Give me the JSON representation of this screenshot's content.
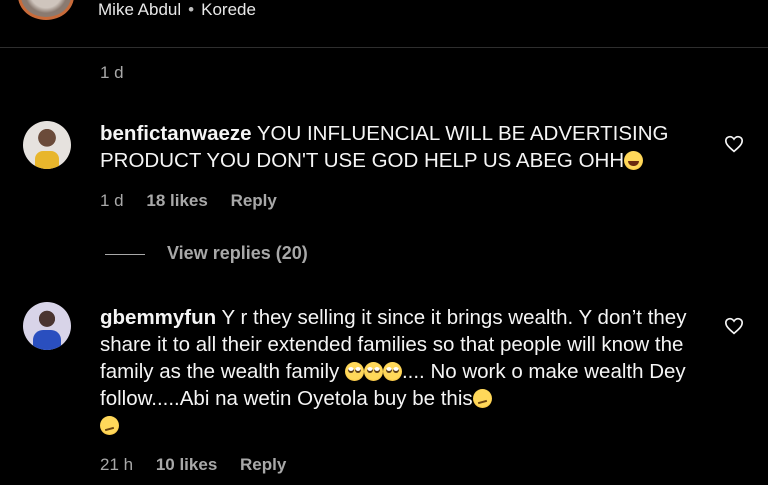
{
  "header": {
    "names": [
      "Mike Abdul",
      "Korede"
    ],
    "separator": "•"
  },
  "top_comment_meta": {
    "time": "1 d"
  },
  "comments": [
    {
      "username": "benfictanwaeze",
      "text": "YOU INFLUENCIAL WILL BE ADVERTISING PRODUCT YOU DON'T USE GOD HELP US ABEG OHH",
      "emoji_end": "laugh-emoji",
      "time": "1 d",
      "likes": "18 likes",
      "reply": "Reply",
      "view_replies": "View replies (20)"
    },
    {
      "username": "gbemmyfun",
      "text_part1": "Y r they selling it since it brings wealth. Y don’t they share it to all their extended families so that people will know the family as the wealth family",
      "text_part2": ".... No work o make wealth Dey follow.....Abi na wetin Oyetola buy be this",
      "time": "21 h",
      "likes": "10 likes",
      "reply": "Reply"
    }
  ],
  "colors": {
    "background": "#000000",
    "text": "#f5f5f5",
    "muted": "#a8a8a8"
  }
}
